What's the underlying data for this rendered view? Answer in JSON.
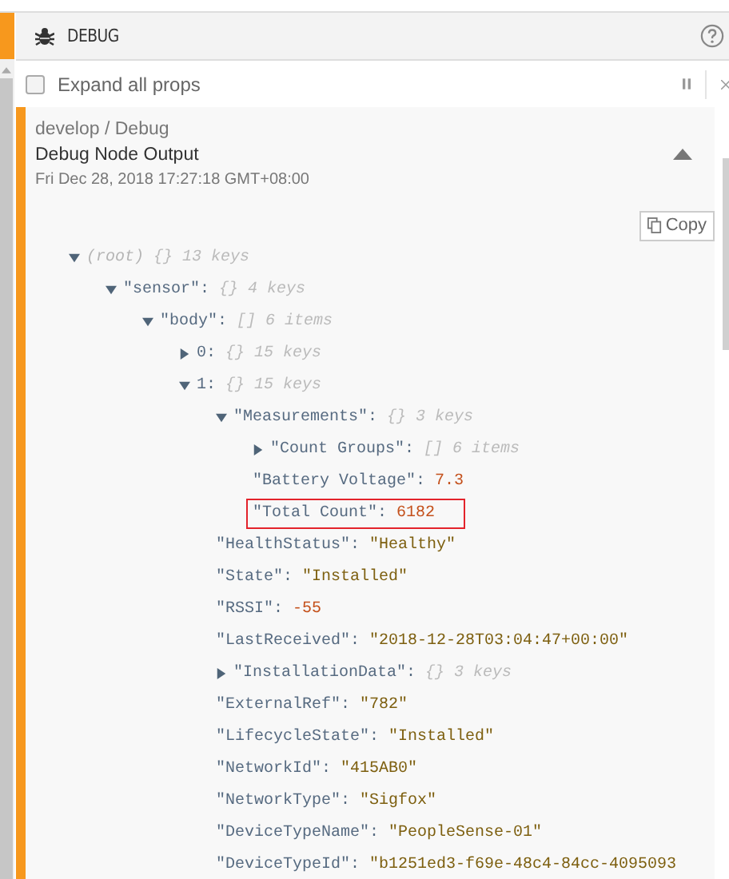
{
  "panel": {
    "title": "DEBUG"
  },
  "toolbar": {
    "expand_all": {
      "label": "Expand all props",
      "checked": false
    }
  },
  "message": {
    "path": "develop / Debug",
    "name": "Debug Node Output",
    "timestamp": "Fri Dec 28, 2018 17:27:18 GMT+08:00",
    "expanded": true,
    "copy_label": "Copy",
    "tree": {
      "kind": "root",
      "key": "(root)",
      "brace": "{}",
      "count": "13 keys",
      "expanded": true,
      "children": [
        {
          "kind": "branch",
          "key": "\"sensor\":",
          "brace": "{}",
          "count": "4 keys",
          "expanded": true,
          "children": [
            {
              "kind": "branch",
              "key": "\"body\":",
              "brace": "[]",
              "count": "6 items",
              "expanded": true,
              "children": [
                {
                  "kind": "branch",
                  "key": "0:",
                  "brace": "{}",
                  "count": "15 keys",
                  "expanded": false
                },
                {
                  "kind": "branch",
                  "key": "1:",
                  "brace": "{}",
                  "count": "15 keys",
                  "expanded": true,
                  "children": [
                    {
                      "kind": "branch",
                      "key": "\"Measurements\":",
                      "brace": "{}",
                      "count": "3 keys",
                      "expanded": true,
                      "children": [
                        {
                          "kind": "branch",
                          "key": "\"Count Groups\":",
                          "brace": "[]",
                          "count": "6 items",
                          "expanded": false
                        },
                        {
                          "kind": "number",
                          "key": "\"Battery Voltage\":",
                          "value": "7.3",
                          "highlighted": false
                        },
                        {
                          "kind": "number",
                          "key": "\"Total Count\":",
                          "value": "6182",
                          "highlighted": true
                        }
                      ]
                    },
                    {
                      "kind": "string",
                      "key": "\"HealthStatus\":",
                      "value": "\"Healthy\""
                    },
                    {
                      "kind": "string",
                      "key": "\"State\":",
                      "value": "\"Installed\""
                    },
                    {
                      "kind": "number",
                      "key": "\"RSSI\":",
                      "value": "-55"
                    },
                    {
                      "kind": "string",
                      "key": "\"LastReceived\":",
                      "value": "\"2018-12-28T03:04:47+00:00\""
                    },
                    {
                      "kind": "branch",
                      "key": "\"InstallationData\":",
                      "brace": "{}",
                      "count": "3 keys",
                      "expanded": false
                    },
                    {
                      "kind": "string",
                      "key": "\"ExternalRef\":",
                      "value": "\"782\""
                    },
                    {
                      "kind": "string",
                      "key": "\"LifecycleState\":",
                      "value": "\"Installed\""
                    },
                    {
                      "kind": "string",
                      "key": "\"NetworkId\":",
                      "value": "\"415AB0\""
                    },
                    {
                      "kind": "string",
                      "key": "\"NetworkType\":",
                      "value": "\"Sigfox\""
                    },
                    {
                      "kind": "string",
                      "key": "\"DeviceTypeName\":",
                      "value": "\"PeopleSense-01\""
                    },
                    {
                      "kind": "string",
                      "key": "\"DeviceTypeId\":",
                      "value": "\"b1251ed3-f69e-48c4-84cc-4095093"
                    }
                  ]
                }
              ]
            }
          ]
        }
      ]
    }
  }
}
